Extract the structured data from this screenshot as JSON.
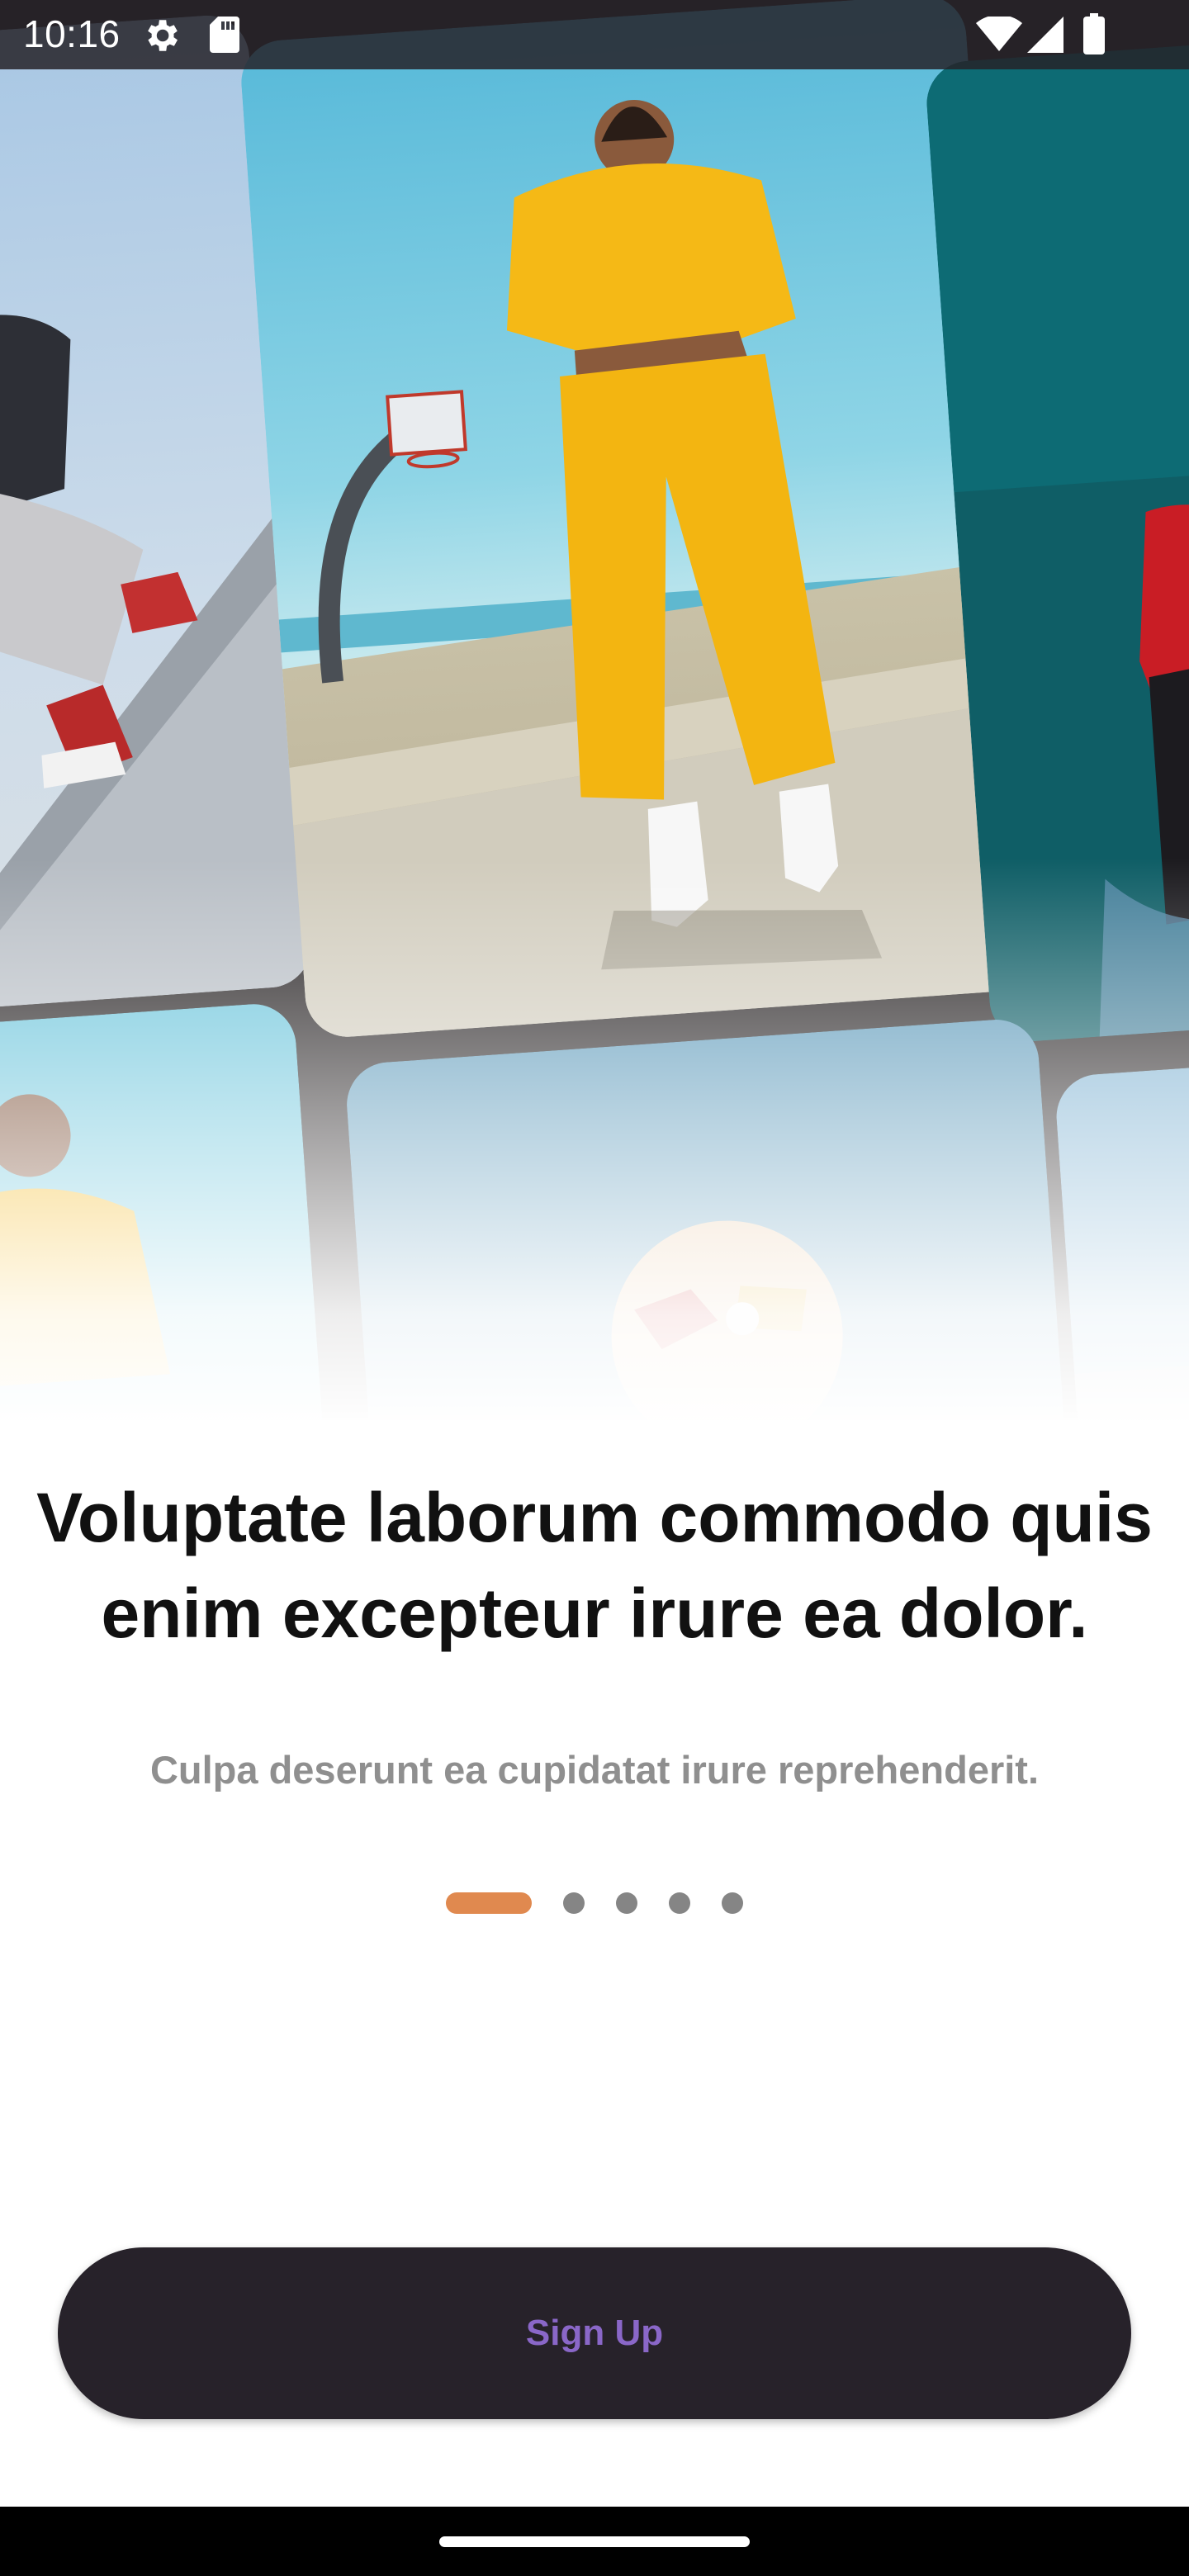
{
  "status_bar": {
    "time": "10:16",
    "icons": [
      "settings-gear-icon",
      "sd-card-icon",
      "wifi-icon",
      "cell-signal-icon",
      "battery-icon"
    ]
  },
  "hero": {
    "images": [
      "photo-sneakers-skater",
      "photo-yellow-tracksuit",
      "photo-red-jacket",
      "photo-yellow-hoodie",
      "photo-sunglasses",
      "photo-outdoor"
    ]
  },
  "onboarding": {
    "headline": "Voluptate laborum commodo quis enim excepteur irure ea dolor.",
    "subtitle": "Culpa deserunt ea cupidatat irure reprehenderit.",
    "page_count": 5,
    "current_page": 1
  },
  "cta": {
    "label": "Sign Up"
  },
  "colors": {
    "accent": "#e0894f",
    "button_bg": "#27222a",
    "button_text": "#8a67c8",
    "inactive_dot": "#858585",
    "subtitle": "#8f8f8f"
  }
}
